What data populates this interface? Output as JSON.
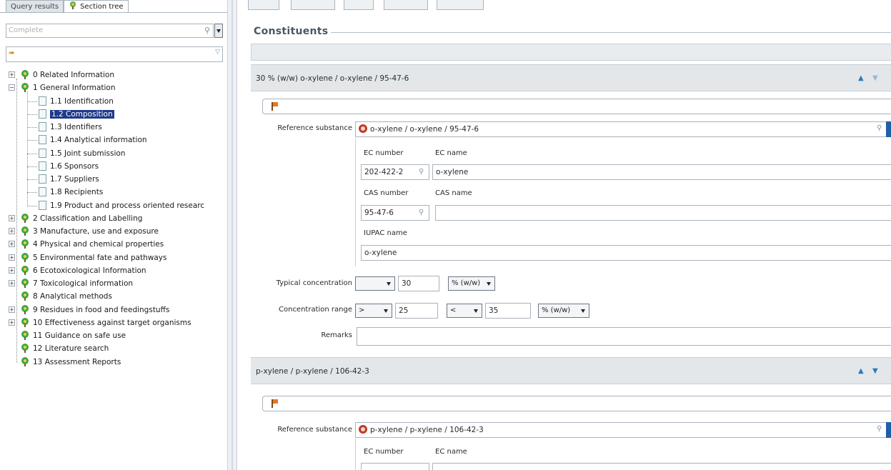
{
  "left_tabs": [
    {
      "label": "Query results"
    },
    {
      "label": "Section tree"
    }
  ],
  "filter": {
    "placeholder": "Complete"
  },
  "tree": [
    {
      "label": "0 Related Information",
      "level": 0,
      "expander": "+"
    },
    {
      "label": "1 General Information",
      "level": 0,
      "expander": "−"
    },
    {
      "label": "1.1 Identification",
      "level": 1
    },
    {
      "label": "1.2 Composition",
      "level": 1,
      "selected": true
    },
    {
      "label": "1.3 Identifiers",
      "level": 1
    },
    {
      "label": "1.4 Analytical information",
      "level": 1
    },
    {
      "label": "1.5 Joint submission",
      "level": 1
    },
    {
      "label": "1.6 Sponsors",
      "level": 1
    },
    {
      "label": "1.7 Suppliers",
      "level": 1
    },
    {
      "label": "1.8 Recipients",
      "level": 1
    },
    {
      "label": "1.9 Product and process oriented researc",
      "level": 1
    },
    {
      "label": "2 Classification and Labelling",
      "level": 0,
      "expander": "+"
    },
    {
      "label": "3 Manufacture, use and exposure",
      "level": 0,
      "expander": "+"
    },
    {
      "label": "4 Physical and chemical properties",
      "level": 0,
      "expander": "+"
    },
    {
      "label": "5 Environmental fate and pathways",
      "level": 0,
      "expander": "+"
    },
    {
      "label": "6 Ecotoxicological Information",
      "level": 0,
      "expander": "+"
    },
    {
      "label": "7 Toxicological information",
      "level": 0,
      "expander": "+"
    },
    {
      "label": "8 Analytical methods",
      "level": 0
    },
    {
      "label": "9 Residues in food and feedingstuffs",
      "level": 0,
      "expander": "+"
    },
    {
      "label": "10 Effectiveness against target organisms",
      "level": 0,
      "expander": "+"
    },
    {
      "label": "11 Guidance on safe use",
      "level": 0
    },
    {
      "label": "12 Literature search",
      "level": 0
    },
    {
      "label": "13 Assessment Reports",
      "level": 0
    }
  ],
  "section_title": "Constituents",
  "constituents": [
    {
      "header": "30 % (w/w) o-xylene / o-xylene / 95-47-6",
      "reference_label": "Reference substance",
      "reference_value": "o-xylene / o-xylene / 95-47-6",
      "ec_number_label": "EC number",
      "ec_name_label": "EC name",
      "ec_number": "202-422-2",
      "ec_name": "o-xylene",
      "cas_number_label": "CAS number",
      "cas_name_label": "CAS name",
      "cas_number": "95-47-6",
      "cas_name": "",
      "iupac_label": "IUPAC name",
      "iupac_name": "o-xylene",
      "typical_label": "Typical concentration",
      "typical_qualifier": "",
      "typical_value": "30",
      "typical_unit": "% (w/w)",
      "range_label": "Concentration range",
      "range_lower_qualifier": ">",
      "range_lower": "25",
      "range_upper_qualifier": "<",
      "range_upper": "35",
      "range_unit": "% (w/w)",
      "remarks_label": "Remarks",
      "remarks": ""
    },
    {
      "header": "p-xylene / p-xylene / 106-42-3",
      "reference_label": "Reference substance",
      "reference_value": "p-xylene / p-xylene / 106-42-3",
      "ec_number_label": "EC number",
      "ec_name_label": "EC name"
    }
  ]
}
